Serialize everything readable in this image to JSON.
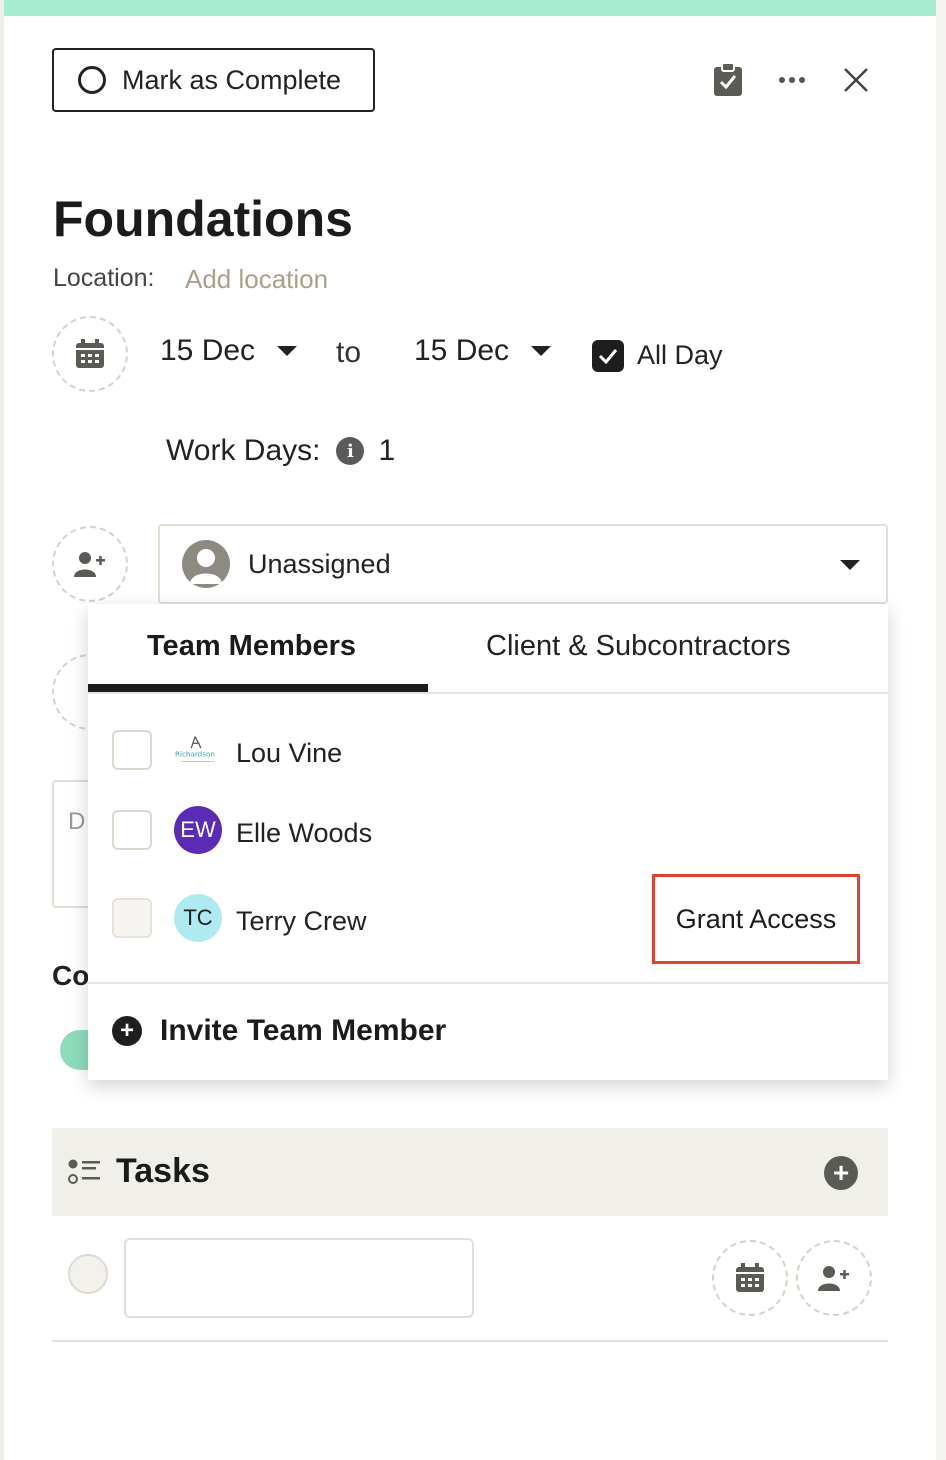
{
  "header": {
    "mark_complete_label": "Mark as Complete"
  },
  "event": {
    "title": "Foundations",
    "location_label": "Location:",
    "location_link": "Add location",
    "start_date": "15 Dec",
    "to_label": "to",
    "end_date": "15 Dec",
    "all_day_label": "All Day",
    "all_day_checked": true,
    "work_days_label": "Work Days:",
    "work_days_value": "1"
  },
  "assignee": {
    "selected": "Unassigned"
  },
  "background": {
    "field_initial": "D",
    "section_initial": "Co"
  },
  "dropdown": {
    "tabs": [
      {
        "label": "Team Members",
        "active": true
      },
      {
        "label": "Client & Subcontractors",
        "active": false
      }
    ],
    "members": [
      {
        "name": "Lou Vine",
        "initials": "",
        "avatar": "richardson-logo"
      },
      {
        "name": "Elle Woods",
        "initials": "EW",
        "avatar_color": "#5b2bb5"
      },
      {
        "name": "Terry Crew",
        "initials": "TC",
        "avatar_color": "#aeeaf0",
        "action": "Grant Access"
      }
    ],
    "logo_text": "Richardson",
    "invite_label": "Invite Team Member"
  },
  "tasks": {
    "title": "Tasks"
  },
  "colors": {
    "accent_strip": "#a6ebd2",
    "highlight": "#e0422f",
    "link_muted": "#a8a089"
  }
}
